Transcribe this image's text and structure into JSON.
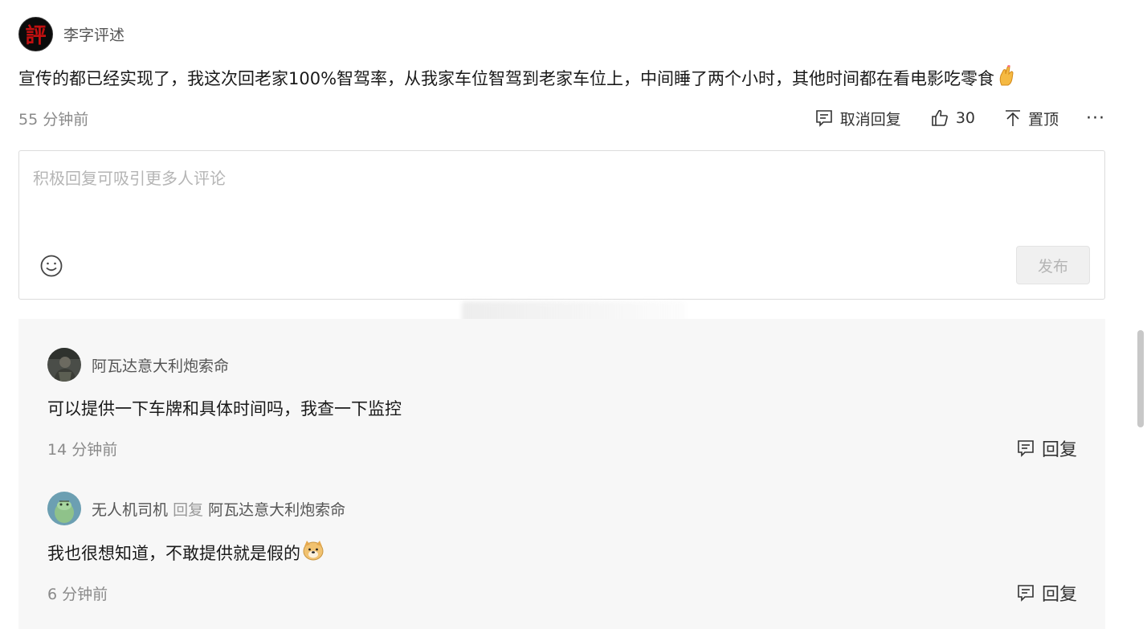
{
  "main_comment": {
    "avatar_char": "評",
    "author": "李字评述",
    "text": "宣传的都已经实现了，我这次回老家100%智驾率，从我家车位智驾到老家车位上，中间睡了两个小时，其他时间都在看电影吃零食",
    "time": "55 分钟前",
    "cancel_reply_label": "取消回复",
    "like_count": "30",
    "pin_label": "置顶",
    "more_label": "···"
  },
  "reply_box": {
    "placeholder": "积极回复可吸引更多人评论",
    "publish_label": "发布"
  },
  "sub_replies": [
    {
      "author": "阿瓦达意大利炮索命",
      "text": "可以提供一下车牌和具体时间吗，我查一下监控",
      "time": "14 分钟前",
      "reply_label": "回复"
    },
    {
      "author": "无人机司机",
      "reply_word": "回复",
      "reply_to": "阿瓦达意大利炮索命",
      "text": "我也很想知道，不敢提供就是假的",
      "time": "6 分钟前",
      "reply_label": "回复"
    }
  ],
  "icons": {
    "comment": "comment-icon",
    "like": "thumb-up-icon",
    "pin": "pin-top-icon",
    "emoji": "smile-icon",
    "hand_emoji": "finger-heart-emoji",
    "doge_emoji": "doge-emoji"
  }
}
